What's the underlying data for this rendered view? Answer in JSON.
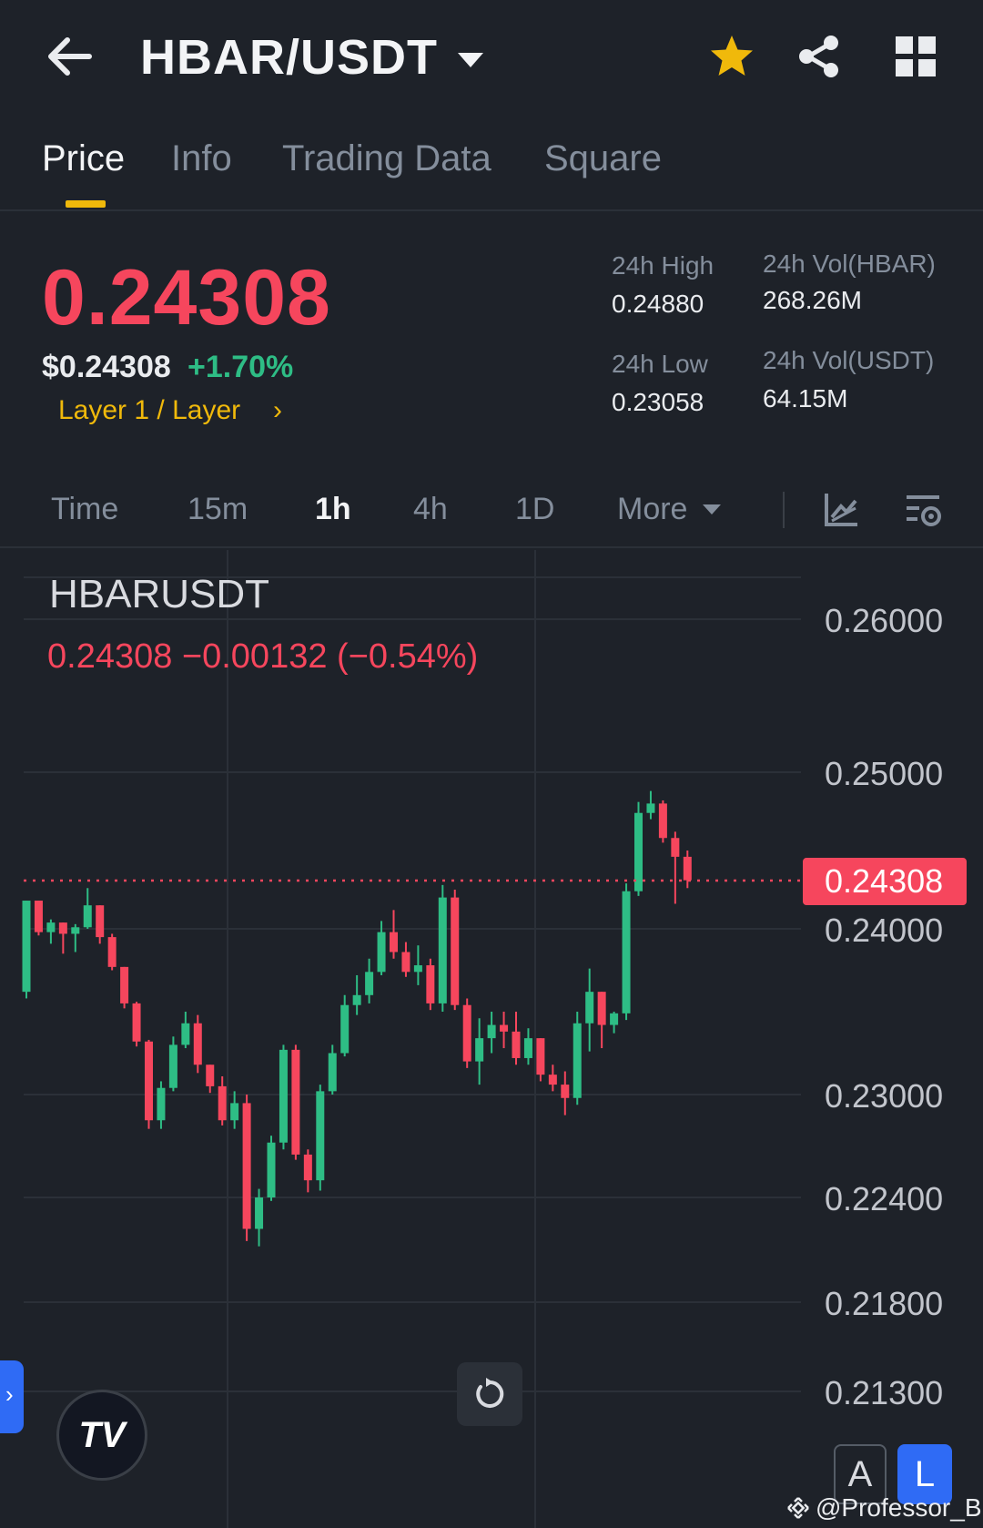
{
  "header": {
    "pair": "HBAR/USDT"
  },
  "tabs": [
    {
      "label": "Price",
      "active": true
    },
    {
      "label": "Info",
      "active": false
    },
    {
      "label": "Trading Data",
      "active": false
    },
    {
      "label": "Square",
      "active": false
    }
  ],
  "ticker": {
    "last_price": "0.24308",
    "usd_price": "$0.24308",
    "change_pct": "+1.70%",
    "tag": "Layer 1 / Layer",
    "tag_chevron": "›",
    "high_label": "24h High",
    "high_value": "0.24880",
    "low_label": "24h Low",
    "low_value": "0.23058",
    "vol_base_label": "24h Vol(HBAR)",
    "vol_base_value": "268.26M",
    "vol_quote_label": "24h Vol(USDT)",
    "vol_quote_value": "64.15M"
  },
  "intervals": {
    "items": [
      {
        "label": "Time",
        "active": false
      },
      {
        "label": "15m",
        "active": false
      },
      {
        "label": "1h",
        "active": true
      },
      {
        "label": "4h",
        "active": false
      },
      {
        "label": "1D",
        "active": false
      },
      {
        "label": "More",
        "active": false
      }
    ]
  },
  "chart": {
    "symbol": "HBARUSDT",
    "ohlc_line": "0.24308  −0.00132 (−0.54%)",
    "last_price_label": "0.24308",
    "y_tick_labels": [
      "0.26000",
      "0.25000",
      "0.24000",
      "0.23000",
      "0.22400",
      "0.21800",
      "0.21300"
    ],
    "side_tab_glyph": "›",
    "tv_logo": "TV",
    "btn_a": "A",
    "btn_l": "L",
    "up_color": "#2ebd85",
    "down_color": "#f6465d",
    "watermark": "@Professor_Bit"
  },
  "chart_data": {
    "type": "candlestick",
    "last_price": 0.24308,
    "candles": [
      {
        "o": 0.2362,
        "h": 0.2418,
        "l": 0.2358,
        "c": 0.2418
      },
      {
        "o": 0.2418,
        "h": 0.2418,
        "l": 0.2396,
        "c": 0.2398
      },
      {
        "o": 0.2398,
        "h": 0.2406,
        "l": 0.2391,
        "c": 0.2404
      },
      {
        "o": 0.2404,
        "h": 0.2404,
        "l": 0.2385,
        "c": 0.2397
      },
      {
        "o": 0.2397,
        "h": 0.2403,
        "l": 0.2386,
        "c": 0.2401
      },
      {
        "o": 0.2401,
        "h": 0.2426,
        "l": 0.24,
        "c": 0.2415
      },
      {
        "o": 0.2415,
        "h": 0.2415,
        "l": 0.2391,
        "c": 0.2395
      },
      {
        "o": 0.2395,
        "h": 0.2397,
        "l": 0.2375,
        "c": 0.2377
      },
      {
        "o": 0.2377,
        "h": 0.2377,
        "l": 0.2352,
        "c": 0.2355
      },
      {
        "o": 0.2355,
        "h": 0.2356,
        "l": 0.2329,
        "c": 0.2332
      },
      {
        "o": 0.2332,
        "h": 0.2333,
        "l": 0.228,
        "c": 0.2285
      },
      {
        "o": 0.2285,
        "h": 0.2308,
        "l": 0.228,
        "c": 0.2304
      },
      {
        "o": 0.2304,
        "h": 0.2335,
        "l": 0.2302,
        "c": 0.233
      },
      {
        "o": 0.233,
        "h": 0.235,
        "l": 0.2328,
        "c": 0.2343
      },
      {
        "o": 0.2343,
        "h": 0.2348,
        "l": 0.2313,
        "c": 0.2318
      },
      {
        "o": 0.2318,
        "h": 0.2318,
        "l": 0.2301,
        "c": 0.2305
      },
      {
        "o": 0.2305,
        "h": 0.2311,
        "l": 0.2282,
        "c": 0.2285
      },
      {
        "o": 0.2285,
        "h": 0.2302,
        "l": 0.228,
        "c": 0.2295
      },
      {
        "o": 0.2295,
        "h": 0.23,
        "l": 0.2215,
        "c": 0.2222
      },
      {
        "o": 0.2222,
        "h": 0.2245,
        "l": 0.2212,
        "c": 0.224
      },
      {
        "o": 0.224,
        "h": 0.2276,
        "l": 0.2238,
        "c": 0.2272
      },
      {
        "o": 0.2272,
        "h": 0.233,
        "l": 0.2268,
        "c": 0.2327
      },
      {
        "o": 0.2327,
        "h": 0.233,
        "l": 0.2262,
        "c": 0.2265
      },
      {
        "o": 0.2265,
        "h": 0.2268,
        "l": 0.2243,
        "c": 0.225
      },
      {
        "o": 0.225,
        "h": 0.2306,
        "l": 0.2244,
        "c": 0.2302
      },
      {
        "o": 0.2302,
        "h": 0.233,
        "l": 0.23,
        "c": 0.2325
      },
      {
        "o": 0.2325,
        "h": 0.236,
        "l": 0.2323,
        "c": 0.2354
      },
      {
        "o": 0.2354,
        "h": 0.2372,
        "l": 0.2348,
        "c": 0.236
      },
      {
        "o": 0.236,
        "h": 0.2382,
        "l": 0.2355,
        "c": 0.2374
      },
      {
        "o": 0.2374,
        "h": 0.2405,
        "l": 0.2372,
        "c": 0.2398
      },
      {
        "o": 0.2398,
        "h": 0.2412,
        "l": 0.2382,
        "c": 0.2386
      },
      {
        "o": 0.2386,
        "h": 0.2392,
        "l": 0.2371,
        "c": 0.2374
      },
      {
        "o": 0.2374,
        "h": 0.239,
        "l": 0.2366,
        "c": 0.2378
      },
      {
        "o": 0.2378,
        "h": 0.2382,
        "l": 0.2351,
        "c": 0.2355
      },
      {
        "o": 0.2355,
        "h": 0.2428,
        "l": 0.235,
        "c": 0.242
      },
      {
        "o": 0.242,
        "h": 0.2425,
        "l": 0.2351,
        "c": 0.2354
      },
      {
        "o": 0.2354,
        "h": 0.2358,
        "l": 0.2316,
        "c": 0.232
      },
      {
        "o": 0.232,
        "h": 0.2346,
        "l": 0.2306,
        "c": 0.2334
      },
      {
        "o": 0.2334,
        "h": 0.235,
        "l": 0.2325,
        "c": 0.2342
      },
      {
        "o": 0.2342,
        "h": 0.235,
        "l": 0.2328,
        "c": 0.2338
      },
      {
        "o": 0.2338,
        "h": 0.235,
        "l": 0.2318,
        "c": 0.2322
      },
      {
        "o": 0.2322,
        "h": 0.234,
        "l": 0.2318,
        "c": 0.2334
      },
      {
        "o": 0.2334,
        "h": 0.2334,
        "l": 0.2308,
        "c": 0.2312
      },
      {
        "o": 0.2312,
        "h": 0.2318,
        "l": 0.2302,
        "c": 0.2306
      },
      {
        "o": 0.2306,
        "h": 0.2314,
        "l": 0.2288,
        "c": 0.2298
      },
      {
        "o": 0.2298,
        "h": 0.235,
        "l": 0.2294,
        "c": 0.2343
      },
      {
        "o": 0.2343,
        "h": 0.2376,
        "l": 0.2326,
        "c": 0.2362
      },
      {
        "o": 0.2362,
        "h": 0.2362,
        "l": 0.2328,
        "c": 0.2342
      },
      {
        "o": 0.2342,
        "h": 0.235,
        "l": 0.2337,
        "c": 0.2349
      },
      {
        "o": 0.2349,
        "h": 0.2429,
        "l": 0.2345,
        "c": 0.2424
      },
      {
        "o": 0.2424,
        "h": 0.2481,
        "l": 0.2421,
        "c": 0.2474
      },
      {
        "o": 0.2474,
        "h": 0.2488,
        "l": 0.247,
        "c": 0.248
      },
      {
        "o": 0.248,
        "h": 0.2482,
        "l": 0.2455,
        "c": 0.2458
      },
      {
        "o": 0.2458,
        "h": 0.2462,
        "l": 0.2416,
        "c": 0.2446
      },
      {
        "o": 0.2446,
        "h": 0.245,
        "l": 0.2426,
        "c": 0.2431
      }
    ]
  }
}
